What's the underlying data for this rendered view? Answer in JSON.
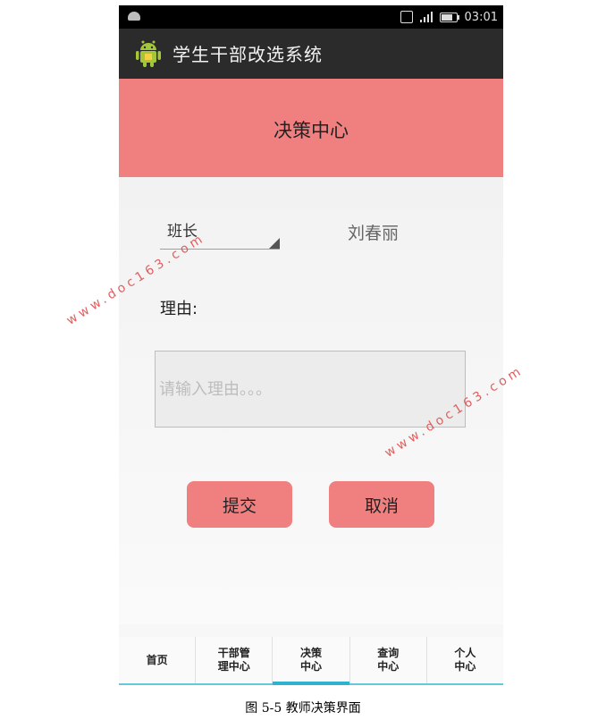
{
  "status_bar": {
    "time": "03:01"
  },
  "app": {
    "title": "学生干部改选系统"
  },
  "header": {
    "title": "决策中心"
  },
  "form": {
    "position_selected": "班长",
    "candidate_name": "刘春丽",
    "reason_label": "理由:",
    "reason_placeholder": "请输入理由。。。",
    "submit_label": "提交",
    "cancel_label": "取消"
  },
  "bottom_nav": {
    "items": [
      {
        "label": "首页"
      },
      {
        "label": "干部管\n理中心"
      },
      {
        "label": "决策\n中心"
      },
      {
        "label": "查询\n中心"
      },
      {
        "label": "个人\n中心"
      }
    ]
  },
  "caption": "图 5-5  教师决策界面",
  "watermark": "www.doc163.com",
  "colors": {
    "accent": "#f08080",
    "nav_active": "#2fb2ce",
    "actionbar": "#2b2b2b"
  }
}
